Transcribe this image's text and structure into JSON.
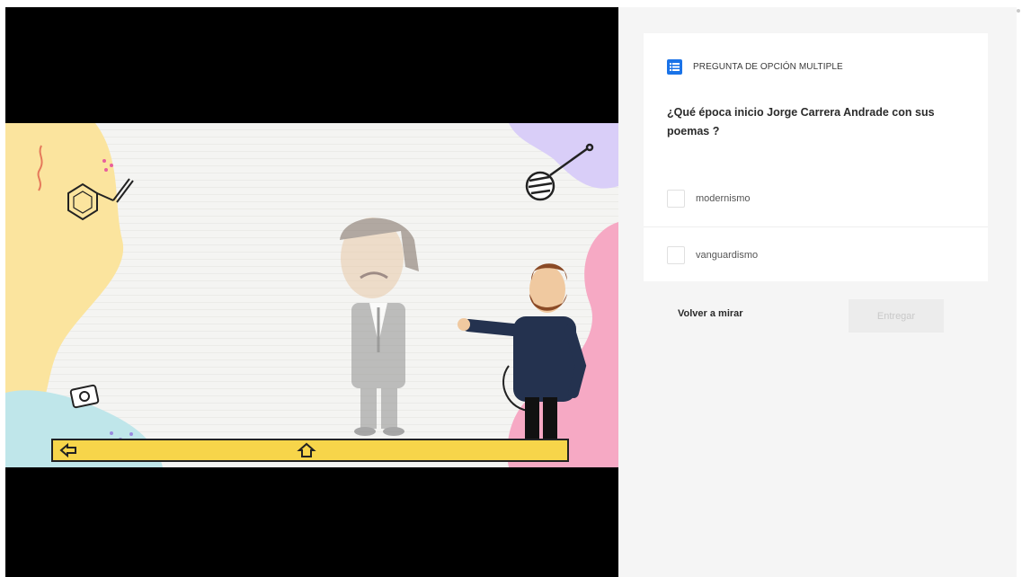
{
  "video": {
    "nav_bar": {
      "back_icon": "arrow-left-icon",
      "home_icon": "home-icon",
      "color": "#f7d54a"
    },
    "colors": {
      "yellow_blob": "#fbe49e",
      "purple_blob": "#d9cef8",
      "pink_blob": "#f6a9c4",
      "teal_blob": "#bfe6ea"
    }
  },
  "quiz": {
    "type_icon": "list-icon",
    "type_label": "PREGUNTA DE OPCIÓN MULTIPLE",
    "question": "¿Qué época inicio Jorge Carrera Andrade con sus poemas ?",
    "options": [
      {
        "label": "modernismo",
        "checked": false
      },
      {
        "label": "vanguardismo",
        "checked": false
      }
    ],
    "rewatch_label": "Volver a mirar",
    "submit_label": "Entregar",
    "accent_color": "#1a73e8"
  }
}
